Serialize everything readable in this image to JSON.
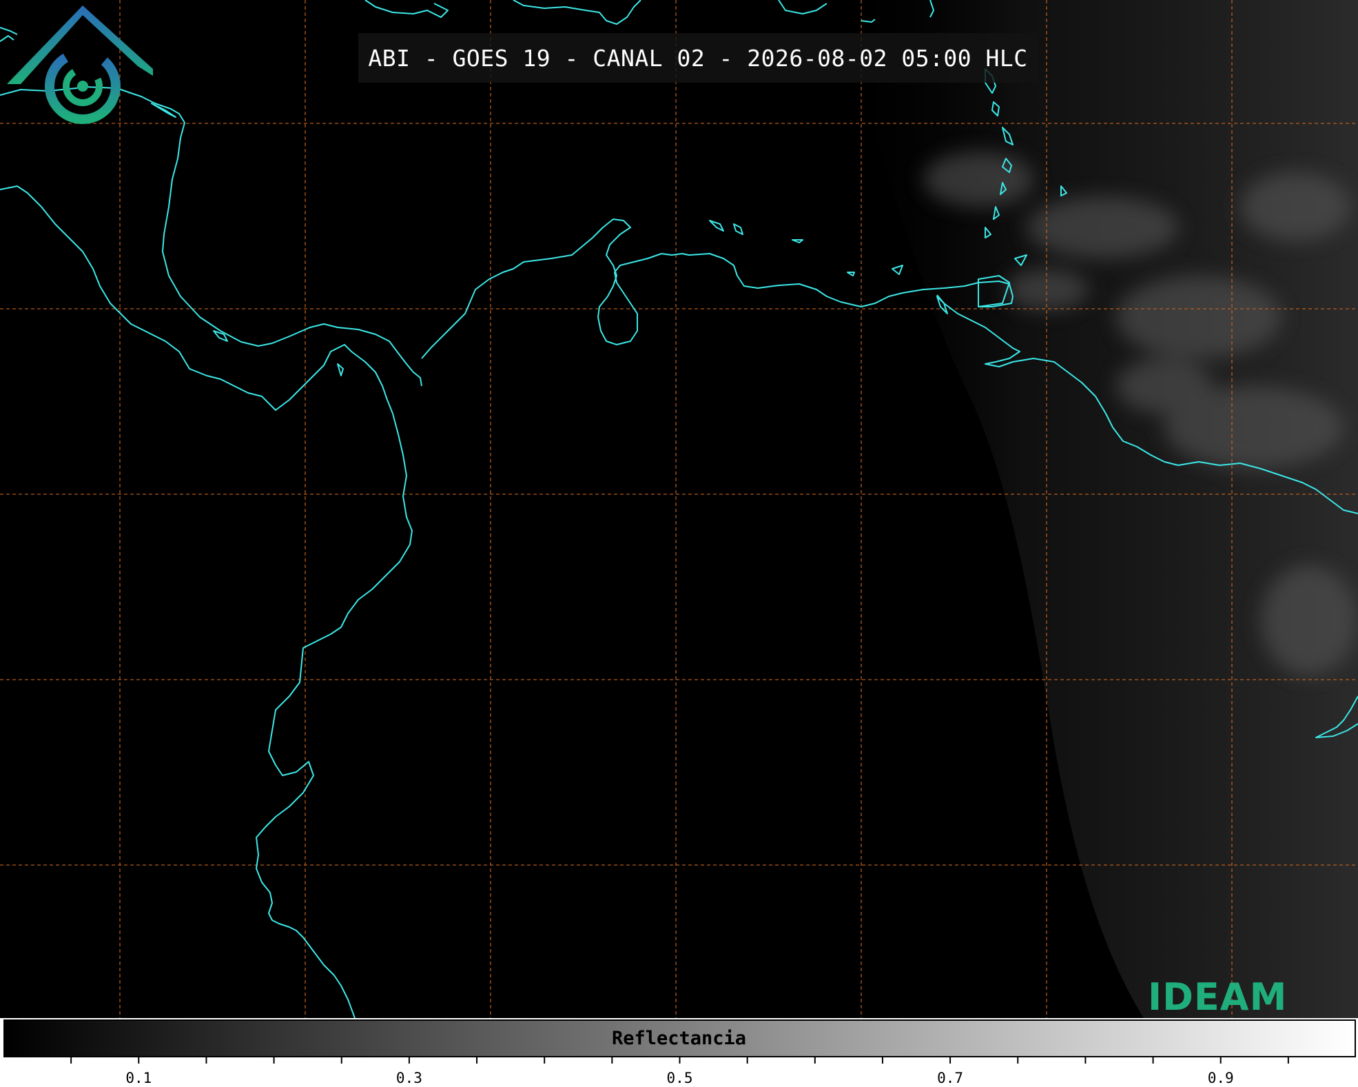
{
  "title": "ABI - GOES 19 - CANAL 02 - 2026-08-02 05:00 HLC",
  "colorbar": {
    "label": "Reflectancia",
    "tick_labels": [
      "0.1",
      "0.3",
      "0.5",
      "0.7",
      "0.9"
    ],
    "tick_values": [
      0.1,
      0.3,
      0.5,
      0.7,
      0.9
    ],
    "range": [
      0.0,
      1.0
    ],
    "minor_step": 0.05,
    "colormap": "grayscale black-to-white"
  },
  "logo": {
    "text": "IDEAM"
  },
  "colors": {
    "background": "#000000",
    "coastline": "#3de8e8",
    "gridline": "#c8641e",
    "logo_green": "#1fae7c",
    "logo_blue": "#2a6db8"
  },
  "map_features": {
    "gridlines": "dashed orange",
    "coastlines": "cyan",
    "daylight_region": "east"
  }
}
